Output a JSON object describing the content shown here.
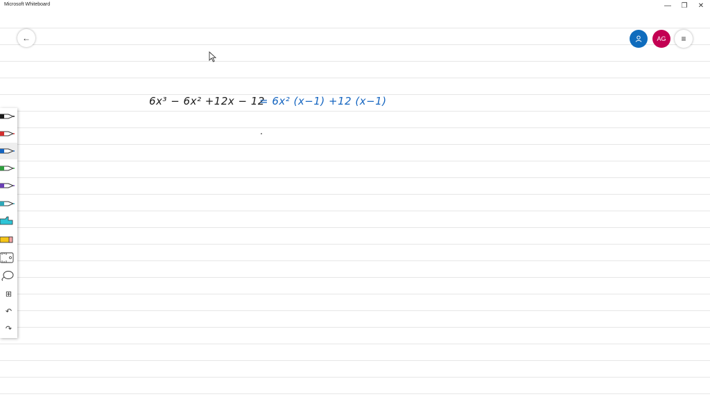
{
  "window": {
    "title": "Microsoft Whiteboard",
    "minimize": "—",
    "restore": "❐",
    "close": "✕"
  },
  "topbar": {
    "back_glyph": "←",
    "share_glyph": "⚇",
    "avatar_initials": "AG",
    "menu_glyph": "≡"
  },
  "toolbar": {
    "tools": [
      {
        "name": "pen-black",
        "color": "#1a1a1a"
      },
      {
        "name": "pen-red",
        "color": "#d32f2f"
      },
      {
        "name": "pen-blue",
        "color": "#1565c0",
        "selected": true
      },
      {
        "name": "pen-green",
        "color": "#2e9e3e"
      },
      {
        "name": "pen-purple",
        "color": "#6a3fb5"
      },
      {
        "name": "pen-teal",
        "color": "#2fa7b8"
      },
      {
        "name": "highlighter",
        "color": "#2ec4d6"
      },
      {
        "name": "eraser",
        "color": "#f5c518"
      },
      {
        "name": "ruler",
        "color": "#333333"
      },
      {
        "name": "lasso",
        "color": "#333333"
      }
    ],
    "add_glyph": "⊞",
    "undo_glyph": "↶",
    "redo_glyph": "↷"
  },
  "canvas": {
    "ink_black": "6x³ − 6x² +12x − 12",
    "ink_blue": "=  6x² (x−1) +12 (x−1)"
  }
}
